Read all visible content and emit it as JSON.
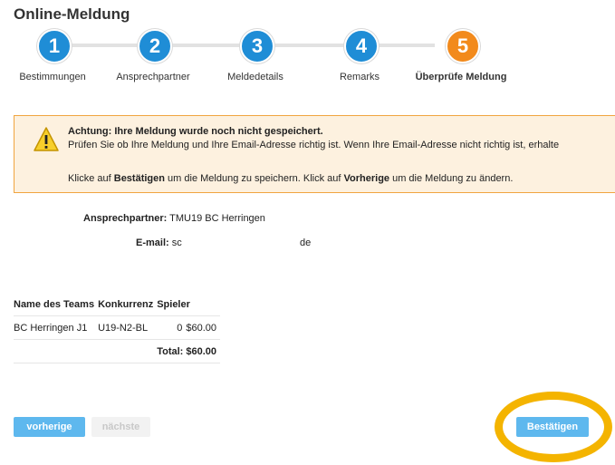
{
  "page": {
    "title": "Online-Meldung"
  },
  "steps": [
    {
      "number": "1",
      "label": "Bestimmungen",
      "active": false
    },
    {
      "number": "2",
      "label": "Ansprechpartner",
      "active": false
    },
    {
      "number": "3",
      "label": "Meldedetails",
      "active": false
    },
    {
      "number": "4",
      "label": "Remarks",
      "active": false
    },
    {
      "number": "5",
      "label": "Überprüfe Meldung",
      "active": true
    }
  ],
  "alert": {
    "heading": "Achtung: Ihre Meldung wurde noch nicht gespeichert.",
    "line2": "Prüfen Sie ob Ihre Meldung und Ihre Email-Adresse richtig ist. Wenn Ihre Email-Adresse nicht richtig ist, erhalte",
    "line3_part1": "Klicke auf ",
    "line3_bold1": "Bestätigen",
    "line3_part2": " um die Meldung zu speichern. Klick auf ",
    "line3_bold2": "Vorherige",
    "line3_part3": " um die Meldung zu ändern."
  },
  "contact": {
    "label": "Ansprechpartner:",
    "value": "TMU19 BC Herringen",
    "email_label": "E-mail:",
    "email_value_start": "sc",
    "email_value_end": "de"
  },
  "table": {
    "headers": [
      "Name des Teams",
      "Konkurrenz",
      "Spieler"
    ],
    "rows": [
      {
        "team": "BC Herringen J1",
        "competition": "U19-N2-BL",
        "players": "0",
        "price": "$60.00"
      }
    ],
    "total_label": "Total:",
    "total_value": "$60.00"
  },
  "buttons": {
    "prev": "vorherige",
    "next": "nächste",
    "confirm": "Bestätigen"
  },
  "colors": {
    "step_blue": "#1f8dd6",
    "step_active": "#f28a1c",
    "alert_bg": "#fdf1df",
    "alert_border": "#f0a540",
    "button_blue": "#5eb8ee",
    "highlight": "#f4b400"
  }
}
